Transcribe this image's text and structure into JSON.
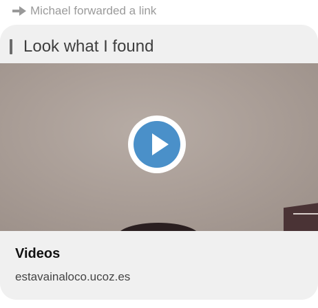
{
  "forward": {
    "icon": "forward-arrow-icon",
    "text": "Michael forwarded a link"
  },
  "message": {
    "text": "Look what I found"
  },
  "preview": {
    "media_icon": "play-icon",
    "title": "Videos",
    "domain": "estavainaloco.ucoz.es"
  },
  "colors": {
    "accent": "#4a90c9",
    "card_background": "#f0f0f0"
  }
}
